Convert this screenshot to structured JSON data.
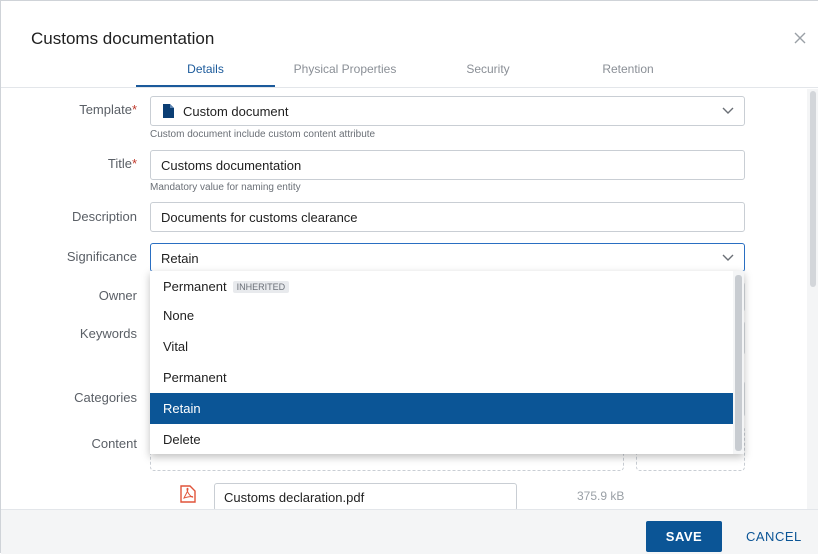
{
  "dialog": {
    "title": "Customs documentation",
    "close_icon": "close-icon"
  },
  "tabs": [
    {
      "label": "Details",
      "active": true
    },
    {
      "label": "Physical Properties",
      "active": false
    },
    {
      "label": "Security",
      "active": false
    },
    {
      "label": "Retention",
      "active": false
    }
  ],
  "form": {
    "template": {
      "label": "Template",
      "required_mark": "*",
      "value": "Custom document",
      "hint": "Custom document include custom content attribute"
    },
    "title": {
      "label": "Title",
      "required_mark": "*",
      "value": "Customs documentation",
      "hint": "Mandatory value for naming entity"
    },
    "description": {
      "label": "Description",
      "value": "Documents for customs clearance"
    },
    "significance": {
      "label": "Significance",
      "value": "Retain"
    },
    "owner": {
      "label": "Owner"
    },
    "keywords": {
      "label": "Keywords"
    },
    "categories": {
      "label": "Categories"
    },
    "content": {
      "label": "Content"
    }
  },
  "significance_options": [
    {
      "label": "Permanent",
      "badge": "INHERITED",
      "selected": false
    },
    {
      "label": "None",
      "badge": "",
      "selected": false
    },
    {
      "label": "Vital",
      "badge": "",
      "selected": false
    },
    {
      "label": "Permanent",
      "badge": "",
      "selected": false
    },
    {
      "label": "Retain",
      "badge": "",
      "selected": true
    },
    {
      "label": "Delete",
      "badge": "",
      "selected": false
    }
  ],
  "attachment": {
    "file_name": "Customs declaration.pdf",
    "size": "375.9 kB",
    "icon": "pdf-icon"
  },
  "footer": {
    "save_label": "SAVE",
    "cancel_label": "CANCEL"
  },
  "colors": {
    "accent": "#0b5596",
    "required": "#c0392b"
  }
}
